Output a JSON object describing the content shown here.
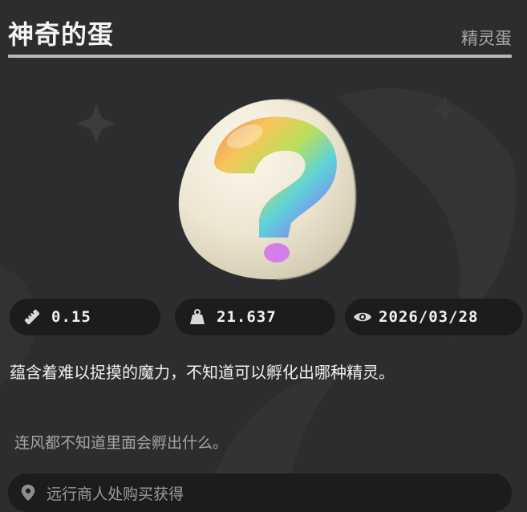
{
  "item": {
    "title": "神奇的蛋",
    "category": "精灵蛋",
    "image_icon": "rainbow-question-egg-icon"
  },
  "stats": {
    "height": {
      "icon": "ruler-icon",
      "value": "0.15"
    },
    "weight": {
      "icon": "weight-icon",
      "value": "21.637"
    },
    "date": {
      "icon": "eye-icon",
      "value": "2026/03/28"
    }
  },
  "description": "蕴含着难以捉摸的魔力，不知道可以孵化出哪种精灵。",
  "flavor_text": "连风都不知道里面会孵出什么。",
  "source": {
    "icon": "location-pin-icon",
    "text": "远行商人处购买获得"
  },
  "colors": {
    "background": "#2c2d2f",
    "pill": "#1c1c1d",
    "rule": "#b9b9b9"
  }
}
